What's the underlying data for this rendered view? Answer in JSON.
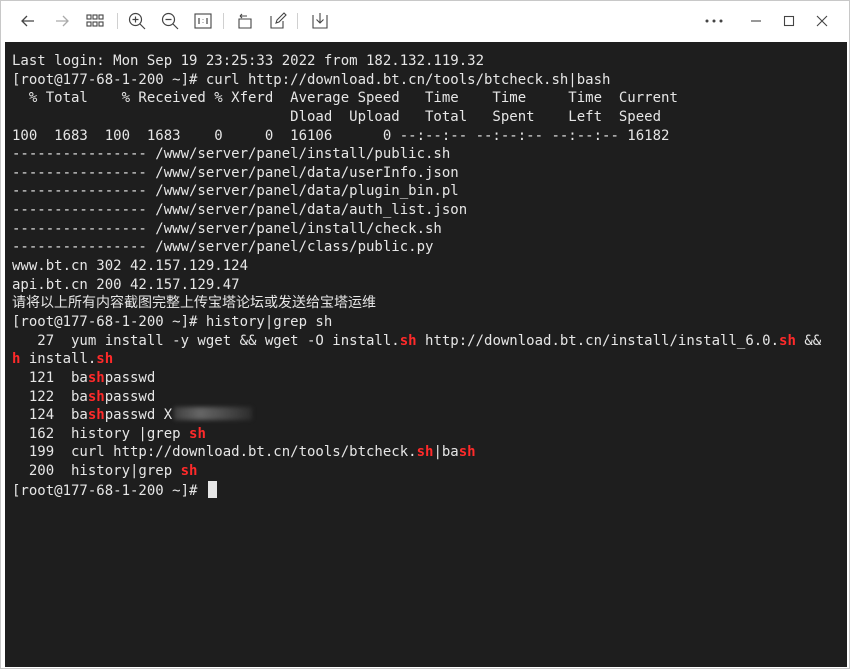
{
  "toolbar": {
    "buttons": [
      {
        "name": "back-button",
        "icon": "arrow-left-icon"
      },
      {
        "name": "forward-button",
        "icon": "arrow-right-icon"
      },
      {
        "name": "thumbnails-button",
        "icon": "grid-icon"
      },
      {
        "name": "zoom-in-button",
        "icon": "zoom-in-icon"
      },
      {
        "name": "zoom-out-button",
        "icon": "zoom-out-icon"
      },
      {
        "name": "actual-size-button",
        "icon": "actual-size-icon"
      },
      {
        "name": "rotate-button",
        "icon": "rotate-icon"
      },
      {
        "name": "edit-button",
        "icon": "edit-icon"
      },
      {
        "name": "save-button",
        "icon": "save-icon"
      },
      {
        "name": "more-button",
        "icon": "more-icon"
      },
      {
        "name": "minimize-button",
        "icon": "minimize-icon"
      },
      {
        "name": "maximize-button",
        "icon": "maximize-icon"
      },
      {
        "name": "close-button",
        "icon": "close-icon"
      }
    ]
  },
  "terminal": {
    "colors": {
      "background": "#1e1e1e",
      "text": "#e6e6e6",
      "highlight": "#ff2a2a"
    },
    "lines": [
      [
        {
          "t": "Last login: Mon Sep 19 23:25:33 2022 from 182.132.119.32"
        }
      ],
      [
        {
          "t": "[root@177-68-1-200 ~]# curl http://download.bt.cn/tools/btcheck.sh|bash"
        }
      ],
      [
        {
          "t": "  % Total    % Received % Xferd  Average Speed   Time    Time     Time  Current"
        }
      ],
      [
        {
          "t": "                                 Dload  Upload   Total   Spent    Left  Speed"
        }
      ],
      [
        {
          "t": "100  1683  100  1683    0     0  16106      0 --:--:-- --:--:-- --:--:-- 16182"
        }
      ],
      [
        {
          "t": "---------------- /www/server/panel/install/public.sh"
        }
      ],
      [
        {
          "t": "---------------- /www/server/panel/data/userInfo.json"
        }
      ],
      [
        {
          "t": "---------------- /www/server/panel/data/plugin_bin.pl"
        }
      ],
      [
        {
          "t": "---------------- /www/server/panel/data/auth_list.json"
        }
      ],
      [
        {
          "t": "---------------- /www/server/panel/install/check.sh"
        }
      ],
      [
        {
          "t": "---------------- /www/server/panel/class/public.py"
        }
      ],
      [
        {
          "t": "www.bt.cn 302 42.157.129.124"
        }
      ],
      [
        {
          "t": "api.bt.cn 200 42.157.129.47"
        }
      ],
      [
        {
          "t": "请将以上所有内容截图完整上传宝塔论坛或发送给宝塔运维",
          "cjk": true
        }
      ],
      [
        {
          "t": "[root@177-68-1-200 ~]# history|grep sh"
        }
      ],
      [
        {
          "t": "   27  yum install -y wget && wget -O install."
        },
        {
          "t": "sh",
          "hl": true
        },
        {
          "t": " http://download.bt.cn/install/install_6.0."
        },
        {
          "t": "sh",
          "hl": true
        },
        {
          "t": " &&"
        }
      ],
      [
        {
          "t": "h",
          "hl": true
        },
        {
          "t": " install."
        },
        {
          "t": "sh",
          "hl": true
        }
      ],
      [
        {
          "t": "  121  ba"
        },
        {
          "t": "sh",
          "hl": true
        },
        {
          "t": "passwd"
        }
      ],
      [
        {
          "t": "  122  ba"
        },
        {
          "t": "sh",
          "hl": true
        },
        {
          "t": "passwd"
        }
      ],
      [
        {
          "t": "  124  ba"
        },
        {
          "t": "sh",
          "hl": true
        },
        {
          "t": "passwd X"
        },
        {
          "redacted": true
        }
      ],
      [
        {
          "t": "  162  history |grep "
        },
        {
          "t": "sh",
          "hl": true
        }
      ],
      [
        {
          "t": "  199  curl http://download.bt.cn/tools/btcheck."
        },
        {
          "t": "sh",
          "hl": true
        },
        {
          "t": "|ba"
        },
        {
          "t": "sh",
          "hl": true
        }
      ],
      [
        {
          "t": "  200  history|grep "
        },
        {
          "t": "sh",
          "hl": true
        }
      ],
      [
        {
          "t": "[root@177-68-1-200 ~]# "
        },
        {
          "cursor": true
        }
      ]
    ]
  }
}
